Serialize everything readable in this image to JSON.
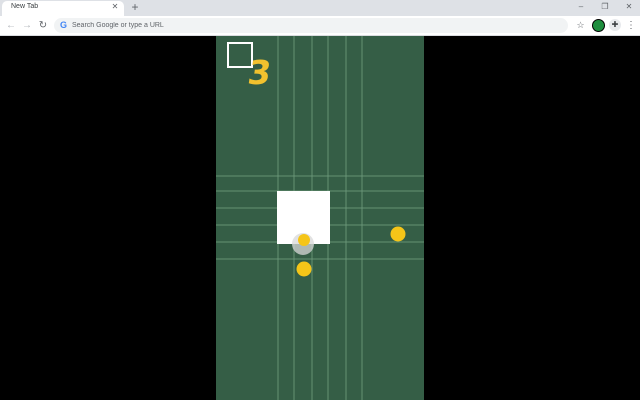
{
  "browser": {
    "tab_title": "New Tab",
    "tab_close_glyph": "✕",
    "new_tab_glyph": "+",
    "window": {
      "minimize_glyph": "–",
      "restore_glyph": "❐",
      "close_glyph": "✕"
    },
    "nav": {
      "back_glyph": "←",
      "forward_glyph": "→",
      "reload_glyph": "↻"
    },
    "omnibox": {
      "icon": "google-g-icon",
      "icon_glyph": "G",
      "placeholder": "Search Google or type a URL",
      "value": ""
    },
    "toolbar_icons": {
      "bookmark_glyph": "☆",
      "extensions_glyph": "✚",
      "menu_glyph": "⋮"
    }
  },
  "game": {
    "score": "3",
    "colors": {
      "board": "#355e46",
      "line": "#6e9a7c",
      "player": "#ffffff",
      "coin": "#f5c518",
      "score": "#f2c12e",
      "ghost": "#d8d8d8"
    },
    "coins_visible": 3,
    "ghost_coins_visible": 1
  }
}
